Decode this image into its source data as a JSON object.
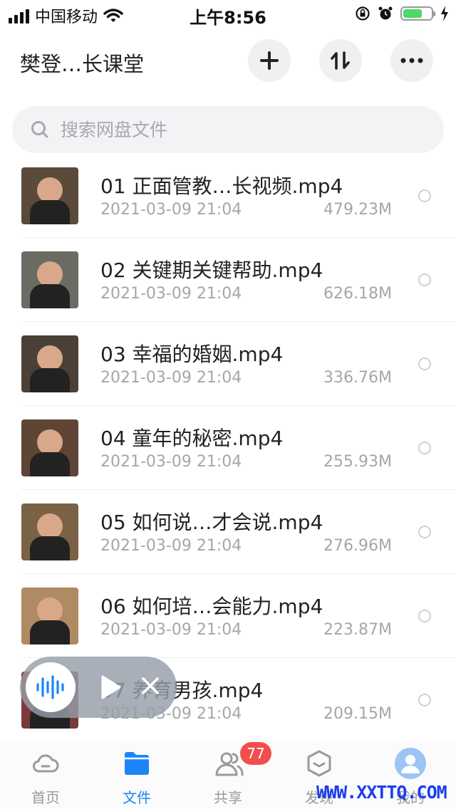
{
  "status_bar": {
    "carrier": "中国移动",
    "time": "上午8:56",
    "battery_level": 0.62
  },
  "header": {
    "title": "樊登…长课堂"
  },
  "search": {
    "placeholder": "搜索网盘文件"
  },
  "files": [
    {
      "name": "01 正面管教…长视频.mp4",
      "date": "2021-03-09 21:04",
      "size": "479.23M",
      "thumb_color": "#5a4a3a"
    },
    {
      "name": "02 关键期关键帮助.mp4",
      "date": "2021-03-09 21:04",
      "size": "626.18M",
      "thumb_color": "#6b6b63"
    },
    {
      "name": "03 幸福的婚姻.mp4",
      "date": "2021-03-09 21:04",
      "size": "336.76M",
      "thumb_color": "#4a4036"
    },
    {
      "name": "04 童年的秘密.mp4",
      "date": "2021-03-09 21:04",
      "size": "255.93M",
      "thumb_color": "#5e4536"
    },
    {
      "name": "05 如何说…才会说.mp4",
      "date": "2021-03-09 21:04",
      "size": "276.96M",
      "thumb_color": "#7a6247"
    },
    {
      "name": "06 如何培…会能力.mp4",
      "date": "2021-03-09 21:04",
      "size": "223.87M",
      "thumb_color": "#b08a63"
    },
    {
      "name": "07 养育男孩.mp4",
      "date": "2021-03-09 21:04",
      "size": "209.15M",
      "thumb_color": "#7a3a3a"
    }
  ],
  "player": {},
  "tabs": [
    {
      "label": "首页",
      "icon": "cloud-icon",
      "active": false
    },
    {
      "label": "文件",
      "icon": "folder-icon",
      "active": true
    },
    {
      "label": "共享",
      "icon": "people-icon",
      "active": false,
      "badge": "77"
    },
    {
      "label": "发现",
      "icon": "cube-icon",
      "active": false
    },
    {
      "label": "我的",
      "icon": "avatar-icon",
      "active": false
    }
  ],
  "watermark": "WWW.XXTTQ.COM",
  "colors": {
    "accent": "#1c84f7",
    "badge": "#f24e4e",
    "battery": "#4cd964"
  }
}
